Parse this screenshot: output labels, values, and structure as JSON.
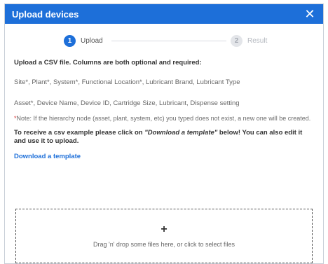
{
  "dialog": {
    "title": "Upload devices",
    "close_glyph": "✕"
  },
  "stepper": {
    "steps": [
      {
        "number": "1",
        "label": "Upload",
        "active": true
      },
      {
        "number": "2",
        "label": "Result",
        "active": false
      }
    ]
  },
  "body": {
    "intro": "Upload a CSV file. Columns are both optional and required:",
    "columns_line_1": "Site*, Plant*, System*, Functional Location*, Lubricant Brand, Lubricant Type",
    "columns_line_2": "Asset*, Device Name, Device ID, Cartridge Size, Lubricant, Dispense setting",
    "note_star": "*",
    "note_text": "Note: If the hierarchy node (asset, plant, system, etc) you typed does not exist, a new one will be created.",
    "template_prefix": "To receive a csv example please click on ",
    "template_emph": "\"Download a template\"",
    "template_suffix": " below! You can also edit it and use it to upload.",
    "download_link": "Download a template"
  },
  "dropzone": {
    "plus_glyph": "+",
    "text": "Drag 'n' drop some files here, or click to select files"
  },
  "colors": {
    "header_bg": "#1d6fd9",
    "link": "#1d6fd9",
    "note_star": "#d93a3a"
  }
}
